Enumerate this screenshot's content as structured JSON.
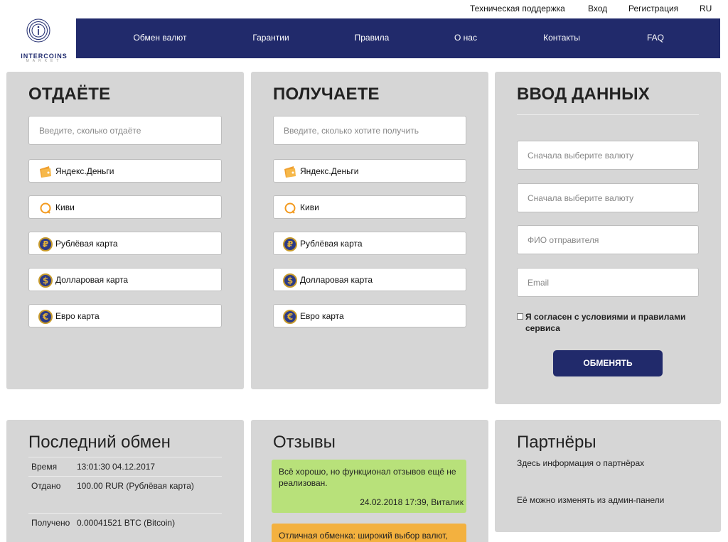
{
  "top_links": {
    "support": "Техническая поддержка",
    "login": "Вход",
    "register": "Регистрация",
    "lang": "RU"
  },
  "logo": {
    "brand": "INTERCOINS",
    "sub": "MARKET"
  },
  "nav": [
    {
      "label": "Обмен валют"
    },
    {
      "label": "Гарантии"
    },
    {
      "label": "Правила"
    },
    {
      "label": "О нас"
    },
    {
      "label": "Контакты"
    },
    {
      "label": "FAQ"
    }
  ],
  "give": {
    "title": "ОТДАЁТЕ",
    "placeholder": "Введите, сколько отдаёте",
    "currencies": [
      {
        "label": "Яндекс.Деньги",
        "icon": "yandex-wallet-icon"
      },
      {
        "label": "Киви",
        "icon": "qiwi-icon"
      },
      {
        "label": "Рублёвая карта",
        "icon": "ruble-coin-icon",
        "symbol": "₽"
      },
      {
        "label": "Долларовая карта",
        "icon": "dollar-coin-icon",
        "symbol": "$"
      },
      {
        "label": "Евро карта",
        "icon": "euro-coin-icon",
        "symbol": "€"
      }
    ]
  },
  "receive": {
    "title": "ПОЛУЧАЕТЕ",
    "placeholder": "Введите, сколько хотите получить",
    "currencies": [
      {
        "label": "Яндекс.Деньги",
        "icon": "yandex-wallet-icon"
      },
      {
        "label": "Киви",
        "icon": "qiwi-icon"
      },
      {
        "label": "Рублёвая карта",
        "icon": "ruble-coin-icon",
        "symbol": "₽"
      },
      {
        "label": "Долларовая карта",
        "icon": "dollar-coin-icon",
        "symbol": "$"
      },
      {
        "label": "Евро карта",
        "icon": "euro-coin-icon",
        "symbol": "€"
      }
    ]
  },
  "data_entry": {
    "title": "ВВОД ДАННЫХ",
    "fields": [
      {
        "placeholder": "Сначала выберите валюту"
      },
      {
        "placeholder": "Сначала выберите валюту"
      },
      {
        "placeholder": "ФИО отправителя"
      },
      {
        "placeholder": "Email"
      }
    ],
    "agree": "Я согласен с условиями и правилами сервиса",
    "submit": "ОБМЕНЯТЬ"
  },
  "last_exchange": {
    "title": "Последний обмен",
    "rows": [
      {
        "key": "Время",
        "value": "13:01:30 04.12.2017"
      },
      {
        "key": "Отдано",
        "value": "100.00 RUR (Рублёвая карта)"
      },
      {
        "key": "Получено",
        "value": "0.00041521 BTC (Bitcoin)"
      }
    ]
  },
  "reviews": {
    "title": "Отзывы",
    "items": [
      {
        "text": "Всё хорошо, но функционал отзывов ещё не реализован.",
        "meta": "24.02.2018 17:39, Виталик",
        "color": "#b8e17a"
      },
      {
        "text": "Отличная обменка: широкий выбор валют,",
        "meta": "",
        "color": "#f3b13f"
      }
    ]
  },
  "partners": {
    "title": "Партнёры",
    "line1": "Здесь информация о партнёрах",
    "line2": "Её можно изменять из админ-панели"
  },
  "colors": {
    "nav_bg": "#212a6b",
    "panel_bg": "#d6d6d6",
    "button_bg": "#212a6b"
  }
}
